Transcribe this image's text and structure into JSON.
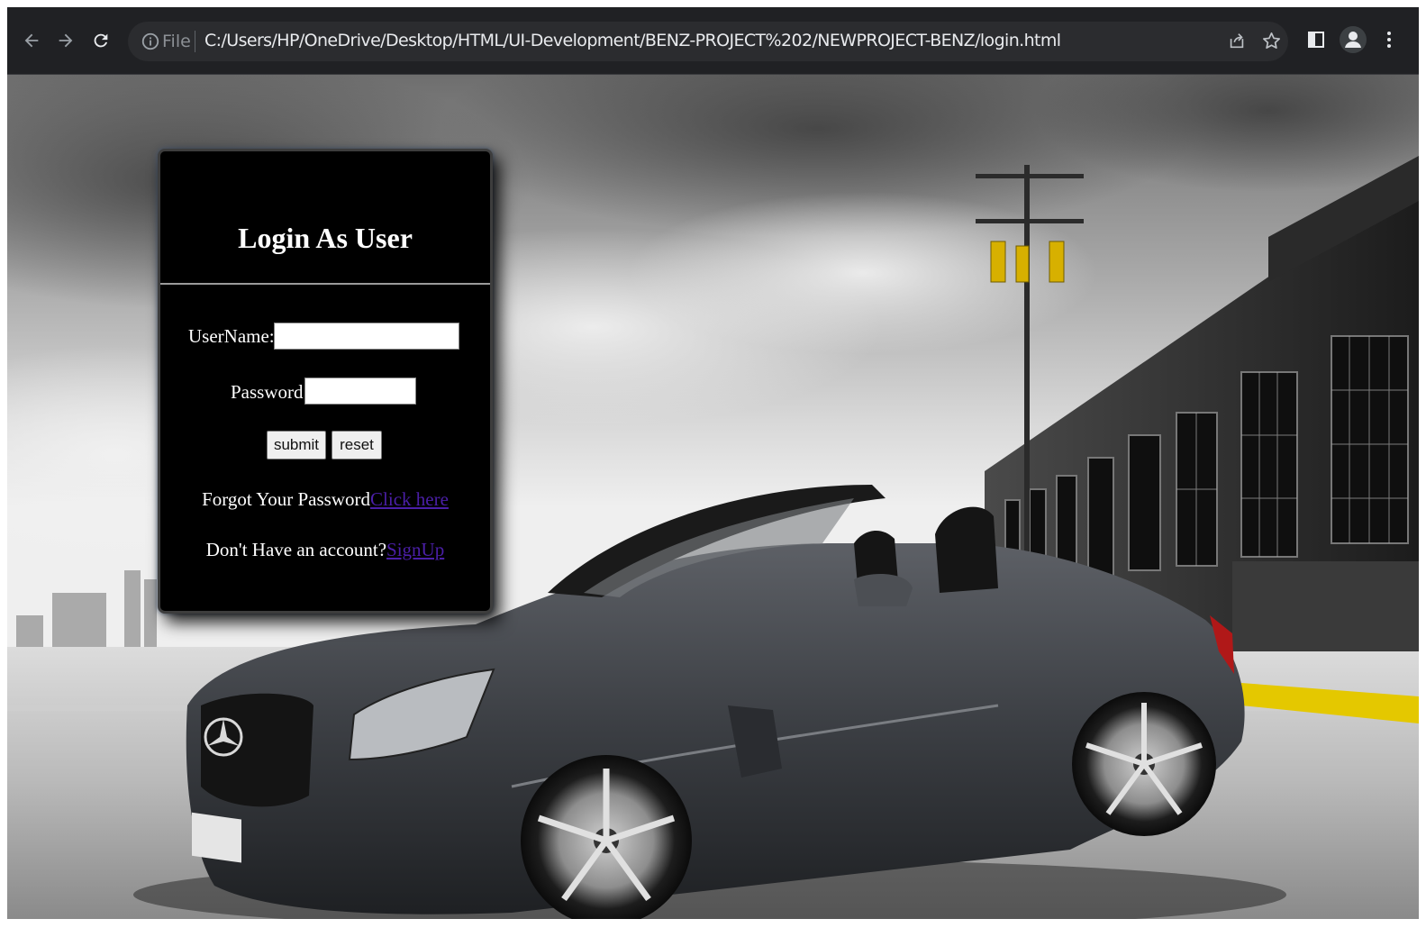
{
  "browser": {
    "back_icon": "arrow-left-icon",
    "forward_icon": "arrow-right-icon",
    "reload_icon": "reload-icon",
    "info_icon": "info-icon",
    "scheme_label": "File",
    "url": "C:/Users/HP/OneDrive/Desktop/HTML/UI-Development/BENZ-PROJECT%202/NEWPROJECT-BENZ/login.html",
    "share_icon": "share-icon",
    "bookmark_icon": "star-icon",
    "sidepanel_icon": "side-panel-icon",
    "profile_icon": "profile-icon",
    "menu_icon": "kebab-menu-icon"
  },
  "login": {
    "title": "Login As User",
    "username_label": "UserName:",
    "username_value": "",
    "password_label": "Password:",
    "password_value": "",
    "submit_label": "submit",
    "reset_label": "reset",
    "forgot_text": "Forgot Your Password",
    "forgot_link": "Click here",
    "account_text": "Don't Have an account?",
    "signup_link": "SignUp"
  },
  "colors": {
    "card_background": "#000000",
    "link": "#4b1fa8",
    "toolbar": "#202124"
  }
}
